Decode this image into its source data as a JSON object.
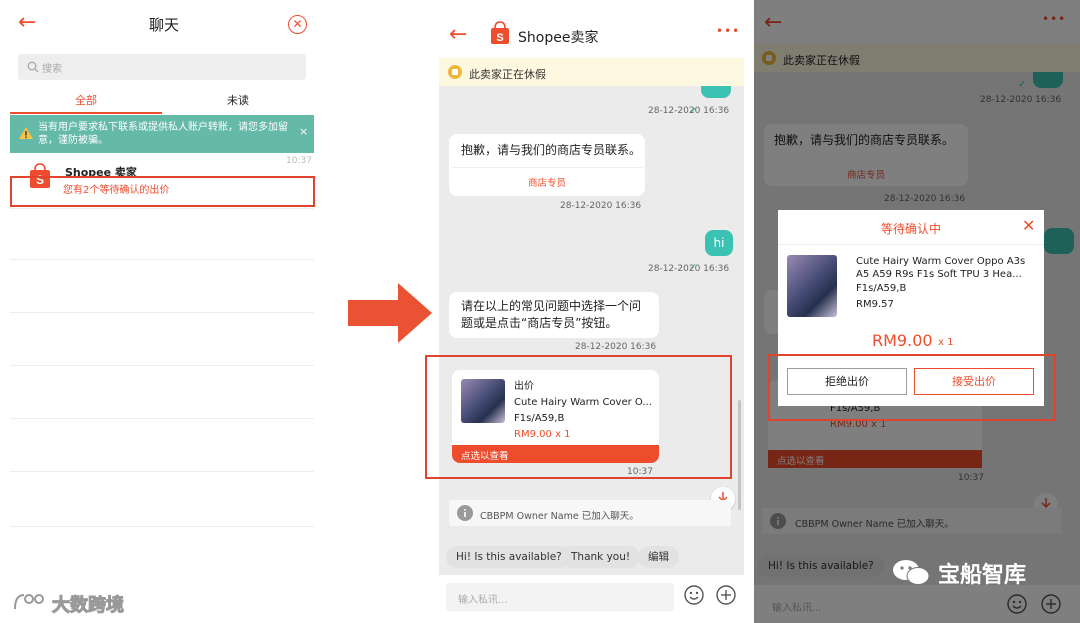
{
  "panel_chat_list": {
    "title": "聊天",
    "search_placeholder": "搜索",
    "tabs": [
      "全部",
      "未读"
    ],
    "warning": "当有用户要求私下联系或提供私人账户转账，请您多加留意，谨防被骗。",
    "warning_close": "×",
    "chat": {
      "name": "Shopee 卖家",
      "time": "10:37",
      "preview": "您有2个等待确认的出价"
    }
  },
  "panel_chat": {
    "title": "Shopee卖家",
    "vacation": "此卖家正在休假",
    "messages": {
      "ts1": "28-12-2020 16:36",
      "sorry": "抱歉，请与我们的商店专员联系。",
      "agent_link": "商店专员",
      "ts2": "28-12-2020 16:36",
      "hi": "hi",
      "ts3": "28-12-2020 16:36",
      "faq": "请在以上的常见问题中选择一个问题或是点击“商店专员”按钮。",
      "ts4": "28-12-2020 16:36"
    },
    "offer": {
      "label": "出价",
      "product": "Cute Hairy Warm Cover O...",
      "variant": "F1s/A59,B",
      "price": "RM9.00 x 1",
      "cta": "点选以查看",
      "time": "10:37"
    },
    "system_notice": "CBBPM Owner Name 已加入聊天。",
    "quick_replies": [
      "Hi! Is this available?",
      "Thank you!",
      "编辑"
    ],
    "input_placeholder": "输入私讯..."
  },
  "panel_modal": {
    "vacation": "此卖家正在休假",
    "ts_top": "28-12-2020 16:36",
    "sorry": "抱歉，请与我们的商店专员联系。",
    "agent_link": "商店专员",
    "ts_mid": "28-12-2020 16:36",
    "bg_variant": "F1s/A59,B",
    "bg_price": "RM9.00 x 1",
    "bg_cta": "点选以查看",
    "bg_time": "10:37",
    "system_notice": "CBBPM Owner Name 已加入聊天。",
    "quick_reply": "Hi! Is this available?",
    "input_placeholder": "输入私讯...",
    "modal": {
      "title": "等待确认中",
      "product": "Cute Hairy Warm Cover Oppo A3s A5 A59 R9s F1s Soft TPU 3 Hea...",
      "variant": "F1s/A59,B",
      "unit_price": "RM9.57",
      "offer_price": "RM9.00",
      "qty": "x 1",
      "reject": "拒绝出价",
      "accept": "接受出价"
    }
  },
  "watermarks": {
    "left": "大数跨境",
    "right": "宝船智库"
  },
  "colors": {
    "brand": "#ee4d2d",
    "teal": "#64b9a9",
    "highlight": "#e0442c"
  }
}
